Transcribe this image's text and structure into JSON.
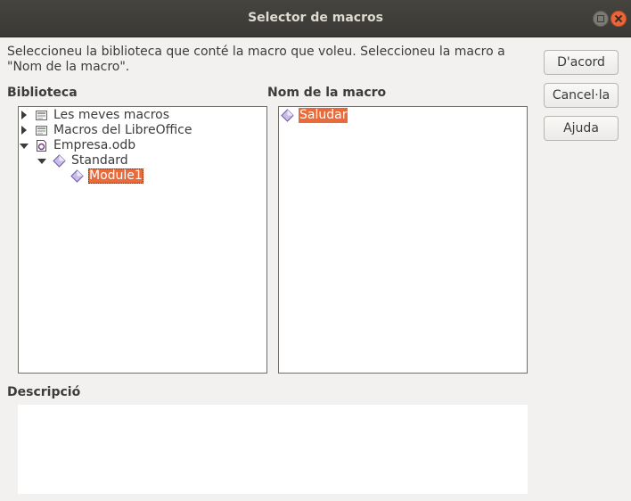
{
  "window": {
    "title": "Selector de macros"
  },
  "instructions": "Seleccioneu la biblioteca que conté la macro que voleu. Seleccioneu la macro a \"Nom de la macro\".",
  "library": {
    "label": "Biblioteca",
    "items": [
      {
        "label": "Les meves macros",
        "icon": "macro-library-icon",
        "expanded": false
      },
      {
        "label": "Macros del LibreOffice",
        "icon": "macro-library-icon",
        "expanded": false
      },
      {
        "label": "Empresa.odb",
        "icon": "base-document-icon",
        "expanded": true
      },
      {
        "label": "Standard",
        "icon": "basic-library-icon",
        "expanded": true
      },
      {
        "label": "Module1",
        "icon": "basic-module-icon",
        "selected": true
      }
    ]
  },
  "macros": {
    "label": "Nom de la macro",
    "items": [
      {
        "label": "Saludar",
        "icon": "basic-macro-icon",
        "selected": true
      }
    ]
  },
  "description": {
    "label": "Descripció",
    "text": ""
  },
  "buttons": {
    "ok": "D'acord",
    "cancel": "Cancel·la",
    "help": "Ajuda"
  },
  "colors": {
    "selection": "#e96b3c",
    "titlebar": "#3d3c37",
    "close_button": "#e9663a"
  }
}
